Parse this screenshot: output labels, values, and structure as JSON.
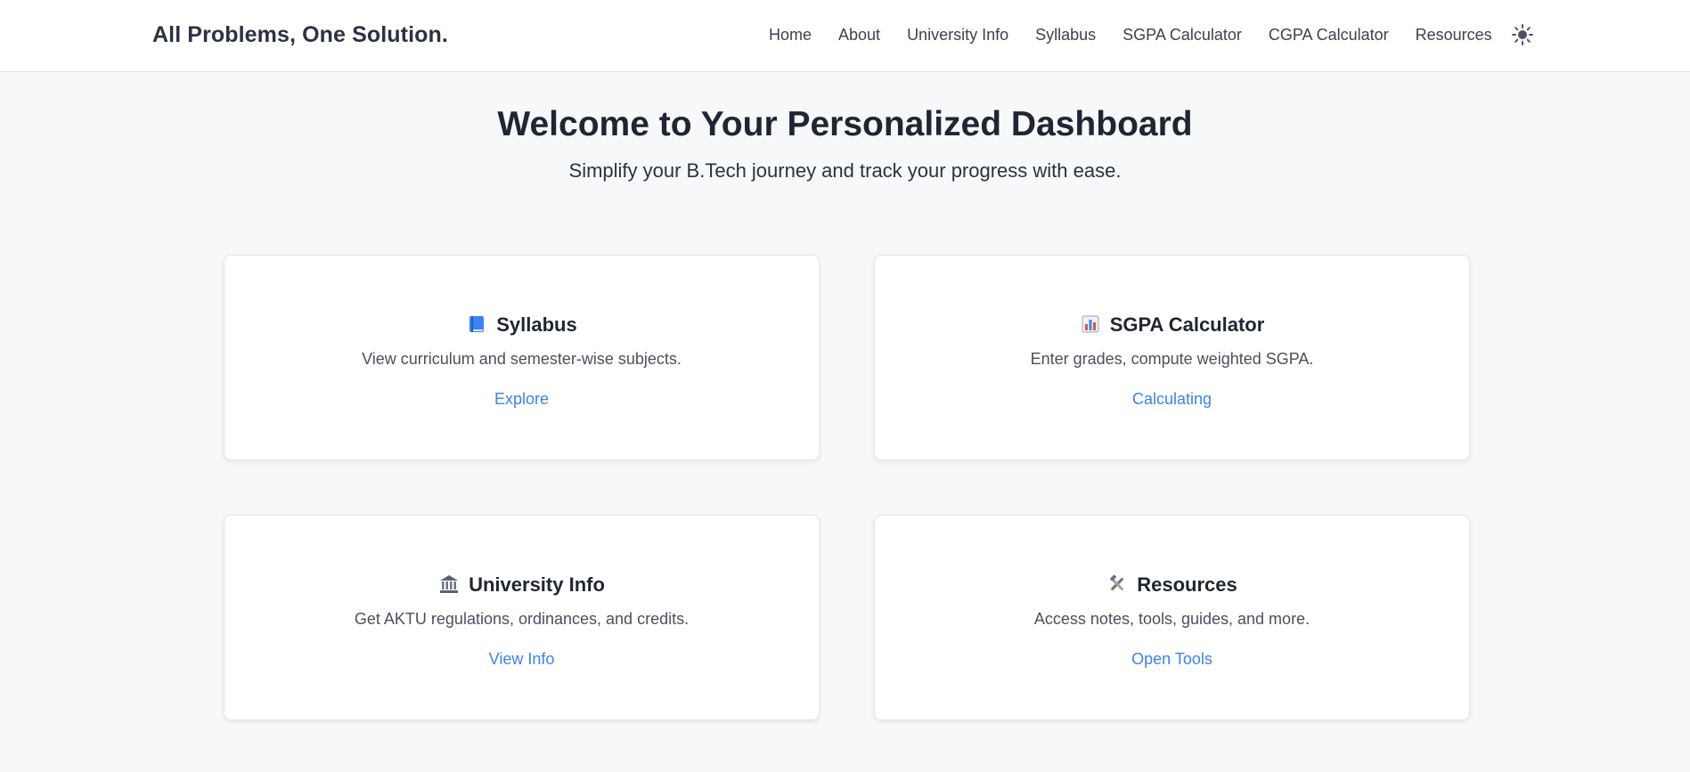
{
  "header": {
    "brand": "All Problems, One Solution.",
    "nav": [
      "Home",
      "About",
      "University Info",
      "Syllabus",
      "SGPA Calculator",
      "CGPA Calculator",
      "Resources"
    ],
    "theme_icon": "sun-icon"
  },
  "hero": {
    "title": "Welcome to Your Personalized Dashboard",
    "subtitle": "Simplify your B.Tech journey and track your progress with ease."
  },
  "cards": [
    {
      "icon": "book-icon",
      "title": "Syllabus",
      "description": "View curriculum and semester-wise subjects.",
      "link": "Explore"
    },
    {
      "icon": "bar-chart-icon",
      "title": "SGPA Calculator",
      "description": "Enter grades, compute weighted SGPA.",
      "link": "Calculating"
    },
    {
      "icon": "bank-icon",
      "title": "University Info",
      "description": "Get AKTU regulations, ordinances, and credits.",
      "link": "View Info"
    },
    {
      "icon": "tools-icon",
      "title": "Resources",
      "description": "Access notes, tools, guides, and more.",
      "link": "Open Tools"
    }
  ],
  "colors": {
    "accent": "#3b82f6",
    "background": "#f7f8fa",
    "card": "#ffffff",
    "text": "#1f2533"
  }
}
